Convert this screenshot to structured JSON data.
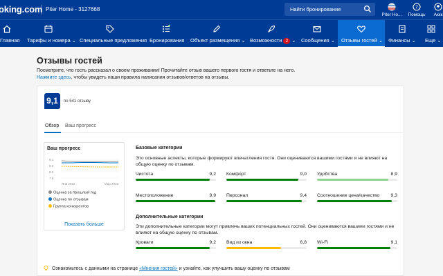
{
  "colors": {
    "brand": "#003b95",
    "active_tab": "#0c6bd1",
    "link": "#0071c2",
    "good": "#008009",
    "mid": "#febb02",
    "high": "#8ed391"
  },
  "header": {
    "brand": "oking.com",
    "hotel": "Piter Home - 3127668",
    "search_placeholder": "Найти бронирование",
    "user_label": "Piter Ho...",
    "help_label": "Помощь",
    "account_label": "Аккк"
  },
  "nav": [
    {
      "label": "Главная",
      "icon": "home-icon"
    },
    {
      "label": "Тарифы и номера",
      "icon": "calendar-icon",
      "dropdown": true
    },
    {
      "label": "Специальные предложения",
      "icon": "tag-icon"
    },
    {
      "label": "Бронирования",
      "icon": "list-icon"
    },
    {
      "label": "Объект размещения",
      "icon": "pencil-icon",
      "dropdown": true
    },
    {
      "label": "Возможности",
      "icon": "rocket-icon",
      "badge": "2",
      "dropdown": true
    },
    {
      "label": "Сообщения",
      "icon": "envelope-icon",
      "dropdown": true
    },
    {
      "label": "Отзывы гостей",
      "icon": "heart-icon",
      "dropdown": true,
      "active": true
    },
    {
      "label": "Финансы",
      "icon": "document-icon",
      "dropdown": true
    },
    {
      "label": "Еще",
      "icon": "grid-icon",
      "dropdown": true
    }
  ],
  "page": {
    "title": "Отзывы гостей",
    "intro": "Посмотрите, что гость рассказал о своем проживании! Прочитайте отзыв вашего первого гостя и ответьте на него.",
    "guidelines_link": "Нажмите здесь",
    "guidelines_text": ", чтобы увидеть наши правила написания отзывов/ответов на отзывы."
  },
  "summary": {
    "score": "9,1",
    "review_count": "по 541 отзыву"
  },
  "tabs": [
    {
      "label": "Обзор",
      "active": true
    },
    {
      "label": "Ваш прогресс",
      "active": false
    }
  ],
  "progress": {
    "title": "Ваш прогресс",
    "y_ticks": [
      "9.1",
      "8.6",
      "8.2",
      "7.8"
    ],
    "x_start": "Янв 2022",
    "x_end": "Мар 2023",
    "legend": [
      {
        "label": "Оценка за прошлый год",
        "color": "#8c8c8c"
      },
      {
        "label": "Оценка по отзывам",
        "color": "#0071c2"
      },
      {
        "label": "Группа конкурентов",
        "color": "#febb02"
      }
    ],
    "show_more": "Показать больше"
  },
  "base": {
    "title": "Базовые категории",
    "desc": "Это основные аспекты, которые формируют впечатления гостя. Они оцениваются вашими гостями и не влияют на общую оценку по отзывам.",
    "items": [
      {
        "name": "Чистота",
        "value": "9,2",
        "fill": 0.92,
        "color": "#008009"
      },
      {
        "name": "Комфорт",
        "value": "9,0",
        "fill": 0.9,
        "color": "#008009"
      },
      {
        "name": "Удобства",
        "value": "8,9",
        "fill": 0.89,
        "color": "#8ed391"
      },
      {
        "name": "Местоположение",
        "value": "9,9",
        "fill": 0.99,
        "color": "#008009"
      },
      {
        "name": "Персонал",
        "value": "9,4",
        "fill": 0.94,
        "color": "#008009"
      },
      {
        "name": "Соотношение цена/качество",
        "value": "9,3",
        "fill": 0.93,
        "color": "#008009"
      }
    ]
  },
  "extra": {
    "title": "Дополнительные категории",
    "desc": "Эти дополнительные категории могут привлечь ваших потенциальных гостей. Они оцениваются вашими гостями и не влияют на общую оценку по отзывам.",
    "items": [
      {
        "name": "Кровати",
        "value": "9,2",
        "fill": 0.92,
        "color": "#008009"
      },
      {
        "name": "Вид из окна",
        "value": "6,8",
        "fill": 0.68,
        "color": "#febb02"
      },
      {
        "name": "Wi-Fi",
        "value": "9,1",
        "fill": 0.91,
        "color": "#008009"
      }
    ]
  },
  "tip": {
    "before": "Ознакомьтесь с данными на странице ",
    "link": "«Мнения гостей»",
    "after": " и узнайте, как улучшить вашу оценку по отзывам"
  }
}
